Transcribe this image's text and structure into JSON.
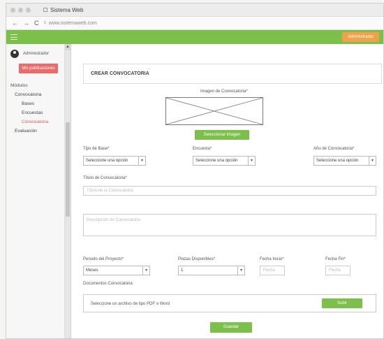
{
  "browser": {
    "tab_title": "Sistema Web",
    "nav_back": "←",
    "nav_forward": "→",
    "nav_reload": "C",
    "url": "www.sistemaweb.com"
  },
  "appbar": {
    "admin_button": "Administrador"
  },
  "sidebar": {
    "user_name": "Administrador",
    "publish_button": "Mis publicaciones",
    "modules_label": "Módulos",
    "items": [
      {
        "label": "Convocatoria"
      },
      {
        "label": "Bases"
      },
      {
        "label": "Encuestas"
      },
      {
        "label": "Convocatoria"
      },
      {
        "label": "Evaluación"
      }
    ]
  },
  "form": {
    "title": "CREAR CONVOCATORIA",
    "image_label": "Imagen de Convocatoria*",
    "select_image_button": "Seleccionar imagen",
    "tipo_base_label": "Tipo de Base*",
    "tipo_base_value": "Seleccione una opción",
    "encuesta_label": "Encuesta*",
    "encuesta_value": "Seleccione una opción",
    "anio_label": "Año de Convocatoria*",
    "anio_value": "Seleccione una opción",
    "titulo_label": "Título de Convocatoria*",
    "titulo_placeholder": "Título de la Convocatoria",
    "descripcion_placeholder": "Descripción de Convocatoria",
    "periodo_label": "Periodo del Proyecto*",
    "periodo_value": "Meses",
    "plazas_label": "Plazas Disponibles*",
    "plazas_value": "1",
    "fecha_inicio_label": "Fecha Inicio*",
    "fecha_inicio_placeholder": "Fecha",
    "fecha_fin_label": "Fecha Fin*",
    "fecha_fin_placeholder": "Fecha",
    "documentos_label": "Documentos Convocatoria",
    "file_text": "Seleccione un archivo de tipo PDF o Word",
    "upload_button": "Subir",
    "save_button": "Guardar"
  },
  "colors": {
    "accent_green": "#7cc04b",
    "admin_orange": "#f0a24b",
    "publish_red": "#e96b6b"
  }
}
